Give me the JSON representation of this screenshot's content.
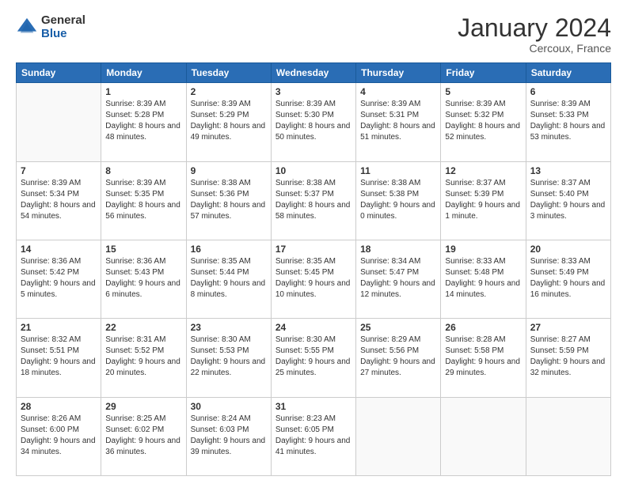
{
  "logo": {
    "general": "General",
    "blue": "Blue"
  },
  "title": "January 2024",
  "location": "Cercoux, France",
  "days_header": [
    "Sunday",
    "Monday",
    "Tuesday",
    "Wednesday",
    "Thursday",
    "Friday",
    "Saturday"
  ],
  "weeks": [
    [
      {
        "day": "",
        "sunrise": "",
        "sunset": "",
        "daylight": ""
      },
      {
        "day": "1",
        "sunrise": "Sunrise: 8:39 AM",
        "sunset": "Sunset: 5:28 PM",
        "daylight": "Daylight: 8 hours and 48 minutes."
      },
      {
        "day": "2",
        "sunrise": "Sunrise: 8:39 AM",
        "sunset": "Sunset: 5:29 PM",
        "daylight": "Daylight: 8 hours and 49 minutes."
      },
      {
        "day": "3",
        "sunrise": "Sunrise: 8:39 AM",
        "sunset": "Sunset: 5:30 PM",
        "daylight": "Daylight: 8 hours and 50 minutes."
      },
      {
        "day": "4",
        "sunrise": "Sunrise: 8:39 AM",
        "sunset": "Sunset: 5:31 PM",
        "daylight": "Daylight: 8 hours and 51 minutes."
      },
      {
        "day": "5",
        "sunrise": "Sunrise: 8:39 AM",
        "sunset": "Sunset: 5:32 PM",
        "daylight": "Daylight: 8 hours and 52 minutes."
      },
      {
        "day": "6",
        "sunrise": "Sunrise: 8:39 AM",
        "sunset": "Sunset: 5:33 PM",
        "daylight": "Daylight: 8 hours and 53 minutes."
      }
    ],
    [
      {
        "day": "7",
        "sunrise": "Sunrise: 8:39 AM",
        "sunset": "Sunset: 5:34 PM",
        "daylight": "Daylight: 8 hours and 54 minutes."
      },
      {
        "day": "8",
        "sunrise": "Sunrise: 8:39 AM",
        "sunset": "Sunset: 5:35 PM",
        "daylight": "Daylight: 8 hours and 56 minutes."
      },
      {
        "day": "9",
        "sunrise": "Sunrise: 8:38 AM",
        "sunset": "Sunset: 5:36 PM",
        "daylight": "Daylight: 8 hours and 57 minutes."
      },
      {
        "day": "10",
        "sunrise": "Sunrise: 8:38 AM",
        "sunset": "Sunset: 5:37 PM",
        "daylight": "Daylight: 8 hours and 58 minutes."
      },
      {
        "day": "11",
        "sunrise": "Sunrise: 8:38 AM",
        "sunset": "Sunset: 5:38 PM",
        "daylight": "Daylight: 9 hours and 0 minutes."
      },
      {
        "day": "12",
        "sunrise": "Sunrise: 8:37 AM",
        "sunset": "Sunset: 5:39 PM",
        "daylight": "Daylight: 9 hours and 1 minute."
      },
      {
        "day": "13",
        "sunrise": "Sunrise: 8:37 AM",
        "sunset": "Sunset: 5:40 PM",
        "daylight": "Daylight: 9 hours and 3 minutes."
      }
    ],
    [
      {
        "day": "14",
        "sunrise": "Sunrise: 8:36 AM",
        "sunset": "Sunset: 5:42 PM",
        "daylight": "Daylight: 9 hours and 5 minutes."
      },
      {
        "day": "15",
        "sunrise": "Sunrise: 8:36 AM",
        "sunset": "Sunset: 5:43 PM",
        "daylight": "Daylight: 9 hours and 6 minutes."
      },
      {
        "day": "16",
        "sunrise": "Sunrise: 8:35 AM",
        "sunset": "Sunset: 5:44 PM",
        "daylight": "Daylight: 9 hours and 8 minutes."
      },
      {
        "day": "17",
        "sunrise": "Sunrise: 8:35 AM",
        "sunset": "Sunset: 5:45 PM",
        "daylight": "Daylight: 9 hours and 10 minutes."
      },
      {
        "day": "18",
        "sunrise": "Sunrise: 8:34 AM",
        "sunset": "Sunset: 5:47 PM",
        "daylight": "Daylight: 9 hours and 12 minutes."
      },
      {
        "day": "19",
        "sunrise": "Sunrise: 8:33 AM",
        "sunset": "Sunset: 5:48 PM",
        "daylight": "Daylight: 9 hours and 14 minutes."
      },
      {
        "day": "20",
        "sunrise": "Sunrise: 8:33 AM",
        "sunset": "Sunset: 5:49 PM",
        "daylight": "Daylight: 9 hours and 16 minutes."
      }
    ],
    [
      {
        "day": "21",
        "sunrise": "Sunrise: 8:32 AM",
        "sunset": "Sunset: 5:51 PM",
        "daylight": "Daylight: 9 hours and 18 minutes."
      },
      {
        "day": "22",
        "sunrise": "Sunrise: 8:31 AM",
        "sunset": "Sunset: 5:52 PM",
        "daylight": "Daylight: 9 hours and 20 minutes."
      },
      {
        "day": "23",
        "sunrise": "Sunrise: 8:30 AM",
        "sunset": "Sunset: 5:53 PM",
        "daylight": "Daylight: 9 hours and 22 minutes."
      },
      {
        "day": "24",
        "sunrise": "Sunrise: 8:30 AM",
        "sunset": "Sunset: 5:55 PM",
        "daylight": "Daylight: 9 hours and 25 minutes."
      },
      {
        "day": "25",
        "sunrise": "Sunrise: 8:29 AM",
        "sunset": "Sunset: 5:56 PM",
        "daylight": "Daylight: 9 hours and 27 minutes."
      },
      {
        "day": "26",
        "sunrise": "Sunrise: 8:28 AM",
        "sunset": "Sunset: 5:58 PM",
        "daylight": "Daylight: 9 hours and 29 minutes."
      },
      {
        "day": "27",
        "sunrise": "Sunrise: 8:27 AM",
        "sunset": "Sunset: 5:59 PM",
        "daylight": "Daylight: 9 hours and 32 minutes."
      }
    ],
    [
      {
        "day": "28",
        "sunrise": "Sunrise: 8:26 AM",
        "sunset": "Sunset: 6:00 PM",
        "daylight": "Daylight: 9 hours and 34 minutes."
      },
      {
        "day": "29",
        "sunrise": "Sunrise: 8:25 AM",
        "sunset": "Sunset: 6:02 PM",
        "daylight": "Daylight: 9 hours and 36 minutes."
      },
      {
        "day": "30",
        "sunrise": "Sunrise: 8:24 AM",
        "sunset": "Sunset: 6:03 PM",
        "daylight": "Daylight: 9 hours and 39 minutes."
      },
      {
        "day": "31",
        "sunrise": "Sunrise: 8:23 AM",
        "sunset": "Sunset: 6:05 PM",
        "daylight": "Daylight: 9 hours and 41 minutes."
      },
      {
        "day": "",
        "sunrise": "",
        "sunset": "",
        "daylight": ""
      },
      {
        "day": "",
        "sunrise": "",
        "sunset": "",
        "daylight": ""
      },
      {
        "day": "",
        "sunrise": "",
        "sunset": "",
        "daylight": ""
      }
    ]
  ]
}
